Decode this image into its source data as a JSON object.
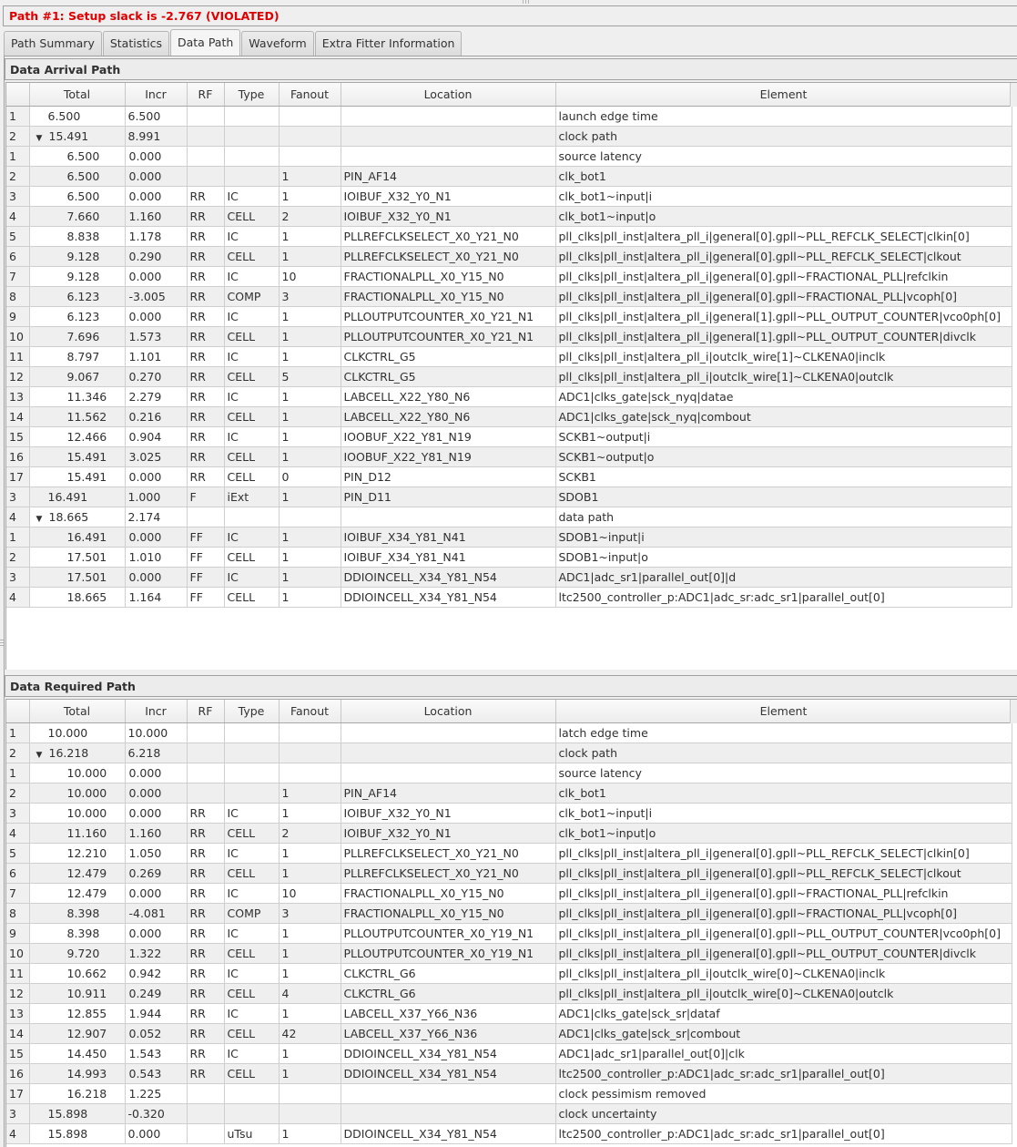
{
  "title": "Path #1: Setup slack is -2.767 (VIOLATED)",
  "colors": {
    "violation": "#e00000"
  },
  "tabs": [
    {
      "label": "Path Summary",
      "active": false
    },
    {
      "label": "Statistics",
      "active": false
    },
    {
      "label": "Data Path",
      "active": true
    },
    {
      "label": "Waveform",
      "active": false
    },
    {
      "label": "Extra Fitter Information",
      "active": false
    }
  ],
  "columns": [
    "",
    "Total",
    "Incr",
    "RF",
    "Type",
    "Fanout",
    "Location",
    "Element"
  ],
  "arrival": {
    "title": "Data Arrival Path",
    "rows": [
      {
        "n": "1",
        "level": 0,
        "total": "6.500",
        "incr": "6.500",
        "rf": "",
        "type": "",
        "fanout": "",
        "location": "",
        "element": "launch edge time"
      },
      {
        "n": "2",
        "level": 0,
        "expanded": true,
        "total": "15.491",
        "incr": "8.991",
        "rf": "",
        "type": "",
        "fanout": "",
        "location": "",
        "element": "clock path"
      },
      {
        "n": "1",
        "level": 1,
        "total": "6.500",
        "incr": "0.000",
        "rf": "",
        "type": "",
        "fanout": "",
        "location": "",
        "element": "source latency"
      },
      {
        "n": "2",
        "level": 1,
        "total": "6.500",
        "incr": "0.000",
        "rf": "",
        "type": "",
        "fanout": "1",
        "location": "PIN_AF14",
        "element": "clk_bot1"
      },
      {
        "n": "3",
        "level": 1,
        "total": "6.500",
        "incr": "0.000",
        "rf": "RR",
        "type": "IC",
        "fanout": "1",
        "location": "IOIBUF_X32_Y0_N1",
        "element": "clk_bot1~input|i"
      },
      {
        "n": "4",
        "level": 1,
        "total": "7.660",
        "incr": "1.160",
        "rf": "RR",
        "type": "CELL",
        "fanout": "2",
        "location": "IOIBUF_X32_Y0_N1",
        "element": "clk_bot1~input|o"
      },
      {
        "n": "5",
        "level": 1,
        "total": "8.838",
        "incr": "1.178",
        "rf": "RR",
        "type": "IC",
        "fanout": "1",
        "location": "PLLREFCLKSELECT_X0_Y21_N0",
        "element": "pll_clks|pll_inst|altera_pll_i|general[0].gpll~PLL_REFCLK_SELECT|clkin[0]"
      },
      {
        "n": "6",
        "level": 1,
        "total": "9.128",
        "incr": "0.290",
        "rf": "RR",
        "type": "CELL",
        "fanout": "1",
        "location": "PLLREFCLKSELECT_X0_Y21_N0",
        "element": "pll_clks|pll_inst|altera_pll_i|general[0].gpll~PLL_REFCLK_SELECT|clkout"
      },
      {
        "n": "7",
        "level": 1,
        "total": "9.128",
        "incr": "0.000",
        "rf": "RR",
        "type": "IC",
        "fanout": "10",
        "location": "FRACTIONALPLL_X0_Y15_N0",
        "element": "pll_clks|pll_inst|altera_pll_i|general[0].gpll~FRACTIONAL_PLL|refclkin"
      },
      {
        "n": "8",
        "level": 1,
        "total": "6.123",
        "incr": "-3.005",
        "rf": "RR",
        "type": "COMP",
        "fanout": "3",
        "location": "FRACTIONALPLL_X0_Y15_N0",
        "element": "pll_clks|pll_inst|altera_pll_i|general[0].gpll~FRACTIONAL_PLL|vcoph[0]"
      },
      {
        "n": "9",
        "level": 1,
        "total": "6.123",
        "incr": "0.000",
        "rf": "RR",
        "type": "IC",
        "fanout": "1",
        "location": "PLLOUTPUTCOUNTER_X0_Y21_N1",
        "element": "pll_clks|pll_inst|altera_pll_i|general[1].gpll~PLL_OUTPUT_COUNTER|vco0ph[0]"
      },
      {
        "n": "10",
        "level": 1,
        "total": "7.696",
        "incr": "1.573",
        "rf": "RR",
        "type": "CELL",
        "fanout": "1",
        "location": "PLLOUTPUTCOUNTER_X0_Y21_N1",
        "element": "pll_clks|pll_inst|altera_pll_i|general[1].gpll~PLL_OUTPUT_COUNTER|divclk"
      },
      {
        "n": "11",
        "level": 1,
        "total": "8.797",
        "incr": "1.101",
        "rf": "RR",
        "type": "IC",
        "fanout": "1",
        "location": "CLKCTRL_G5",
        "element": "pll_clks|pll_inst|altera_pll_i|outclk_wire[1]~CLKENA0|inclk"
      },
      {
        "n": "12",
        "level": 1,
        "total": "9.067",
        "incr": "0.270",
        "rf": "RR",
        "type": "CELL",
        "fanout": "5",
        "location": "CLKCTRL_G5",
        "element": "pll_clks|pll_inst|altera_pll_i|outclk_wire[1]~CLKENA0|outclk"
      },
      {
        "n": "13",
        "level": 1,
        "total": "11.346",
        "incr": "2.279",
        "rf": "RR",
        "type": "IC",
        "fanout": "1",
        "location": "LABCELL_X22_Y80_N6",
        "element": "ADC1|clks_gate|sck_nyq|datae"
      },
      {
        "n": "14",
        "level": 1,
        "total": "11.562",
        "incr": "0.216",
        "rf": "RR",
        "type": "CELL",
        "fanout": "1",
        "location": "LABCELL_X22_Y80_N6",
        "element": "ADC1|clks_gate|sck_nyq|combout"
      },
      {
        "n": "15",
        "level": 1,
        "total": "12.466",
        "incr": "0.904",
        "rf": "RR",
        "type": "IC",
        "fanout": "1",
        "location": "IOOBUF_X22_Y81_N19",
        "element": "SCKB1~output|i"
      },
      {
        "n": "16",
        "level": 1,
        "total": "15.491",
        "incr": "3.025",
        "rf": "RR",
        "type": "CELL",
        "fanout": "1",
        "location": "IOOBUF_X22_Y81_N19",
        "element": "SCKB1~output|o"
      },
      {
        "n": "17",
        "level": 1,
        "total": "15.491",
        "incr": "0.000",
        "rf": "RR",
        "type": "CELL",
        "fanout": "0",
        "location": "PIN_D12",
        "element": "SCKB1"
      },
      {
        "n": "3",
        "level": 0,
        "total": "16.491",
        "incr": "1.000",
        "rf": "F",
        "type": "iExt",
        "fanout": "1",
        "location": "PIN_D11",
        "element": "SDOB1"
      },
      {
        "n": "4",
        "level": 0,
        "expanded": true,
        "total": "18.665",
        "incr": "2.174",
        "rf": "",
        "type": "",
        "fanout": "",
        "location": "",
        "element": "data path"
      },
      {
        "n": "1",
        "level": 1,
        "total": "16.491",
        "incr": "0.000",
        "rf": "FF",
        "type": "IC",
        "fanout": "1",
        "location": "IOIBUF_X34_Y81_N41",
        "element": "SDOB1~input|i"
      },
      {
        "n": "2",
        "level": 1,
        "total": "17.501",
        "incr": "1.010",
        "rf": "FF",
        "type": "CELL",
        "fanout": "1",
        "location": "IOIBUF_X34_Y81_N41",
        "element": "SDOB1~input|o"
      },
      {
        "n": "3",
        "level": 1,
        "total": "17.501",
        "incr": "0.000",
        "rf": "FF",
        "type": "IC",
        "fanout": "1",
        "location": "DDIOINCELL_X34_Y81_N54",
        "element": "ADC1|adc_sr1|parallel_out[0]|d"
      },
      {
        "n": "4",
        "level": 1,
        "total": "18.665",
        "incr": "1.164",
        "rf": "FF",
        "type": "CELL",
        "fanout": "1",
        "location": "DDIOINCELL_X34_Y81_N54",
        "element": "ltc2500_controller_p:ADC1|adc_sr:adc_sr1|parallel_out[0]"
      }
    ]
  },
  "required": {
    "title": "Data Required Path",
    "rows": [
      {
        "n": "1",
        "level": 0,
        "total": "10.000",
        "incr": "10.000",
        "rf": "",
        "type": "",
        "fanout": "",
        "location": "",
        "element": "latch edge time"
      },
      {
        "n": "2",
        "level": 0,
        "expanded": true,
        "total": "16.218",
        "incr": "6.218",
        "rf": "",
        "type": "",
        "fanout": "",
        "location": "",
        "element": "clock path"
      },
      {
        "n": "1",
        "level": 1,
        "total": "10.000",
        "incr": "0.000",
        "rf": "",
        "type": "",
        "fanout": "",
        "location": "",
        "element": "source latency"
      },
      {
        "n": "2",
        "level": 1,
        "total": "10.000",
        "incr": "0.000",
        "rf": "",
        "type": "",
        "fanout": "1",
        "location": "PIN_AF14",
        "element": "clk_bot1"
      },
      {
        "n": "3",
        "level": 1,
        "total": "10.000",
        "incr": "0.000",
        "rf": "RR",
        "type": "IC",
        "fanout": "1",
        "location": "IOIBUF_X32_Y0_N1",
        "element": "clk_bot1~input|i"
      },
      {
        "n": "4",
        "level": 1,
        "total": "11.160",
        "incr": "1.160",
        "rf": "RR",
        "type": "CELL",
        "fanout": "2",
        "location": "IOIBUF_X32_Y0_N1",
        "element": "clk_bot1~input|o"
      },
      {
        "n": "5",
        "level": 1,
        "total": "12.210",
        "incr": "1.050",
        "rf": "RR",
        "type": "IC",
        "fanout": "1",
        "location": "PLLREFCLKSELECT_X0_Y21_N0",
        "element": "pll_clks|pll_inst|altera_pll_i|general[0].gpll~PLL_REFCLK_SELECT|clkin[0]"
      },
      {
        "n": "6",
        "level": 1,
        "total": "12.479",
        "incr": "0.269",
        "rf": "RR",
        "type": "CELL",
        "fanout": "1",
        "location": "PLLREFCLKSELECT_X0_Y21_N0",
        "element": "pll_clks|pll_inst|altera_pll_i|general[0].gpll~PLL_REFCLK_SELECT|clkout"
      },
      {
        "n": "7",
        "level": 1,
        "total": "12.479",
        "incr": "0.000",
        "rf": "RR",
        "type": "IC",
        "fanout": "10",
        "location": "FRACTIONALPLL_X0_Y15_N0",
        "element": "pll_clks|pll_inst|altera_pll_i|general[0].gpll~FRACTIONAL_PLL|refclkin"
      },
      {
        "n": "8",
        "level": 1,
        "total": "8.398",
        "incr": "-4.081",
        "rf": "RR",
        "type": "COMP",
        "fanout": "3",
        "location": "FRACTIONALPLL_X0_Y15_N0",
        "element": "pll_clks|pll_inst|altera_pll_i|general[0].gpll~FRACTIONAL_PLL|vcoph[0]"
      },
      {
        "n": "9",
        "level": 1,
        "total": "8.398",
        "incr": "0.000",
        "rf": "RR",
        "type": "IC",
        "fanout": "1",
        "location": "PLLOUTPUTCOUNTER_X0_Y19_N1",
        "element": "pll_clks|pll_inst|altera_pll_i|general[0].gpll~PLL_OUTPUT_COUNTER|vco0ph[0]"
      },
      {
        "n": "10",
        "level": 1,
        "total": "9.720",
        "incr": "1.322",
        "rf": "RR",
        "type": "CELL",
        "fanout": "1",
        "location": "PLLOUTPUTCOUNTER_X0_Y19_N1",
        "element": "pll_clks|pll_inst|altera_pll_i|general[0].gpll~PLL_OUTPUT_COUNTER|divclk"
      },
      {
        "n": "11",
        "level": 1,
        "total": "10.662",
        "incr": "0.942",
        "rf": "RR",
        "type": "IC",
        "fanout": "1",
        "location": "CLKCTRL_G6",
        "element": "pll_clks|pll_inst|altera_pll_i|outclk_wire[0]~CLKENA0|inclk"
      },
      {
        "n": "12",
        "level": 1,
        "total": "10.911",
        "incr": "0.249",
        "rf": "RR",
        "type": "CELL",
        "fanout": "4",
        "location": "CLKCTRL_G6",
        "element": "pll_clks|pll_inst|altera_pll_i|outclk_wire[0]~CLKENA0|outclk"
      },
      {
        "n": "13",
        "level": 1,
        "total": "12.855",
        "incr": "1.944",
        "rf": "RR",
        "type": "IC",
        "fanout": "1",
        "location": "LABCELL_X37_Y66_N36",
        "element": "ADC1|clks_gate|sck_sr|dataf"
      },
      {
        "n": "14",
        "level": 1,
        "total": "12.907",
        "incr": "0.052",
        "rf": "RR",
        "type": "CELL",
        "fanout": "42",
        "location": "LABCELL_X37_Y66_N36",
        "element": "ADC1|clks_gate|sck_sr|combout"
      },
      {
        "n": "15",
        "level": 1,
        "total": "14.450",
        "incr": "1.543",
        "rf": "RR",
        "type": "IC",
        "fanout": "1",
        "location": "DDIOINCELL_X34_Y81_N54",
        "element": "ADC1|adc_sr1|parallel_out[0]|clk"
      },
      {
        "n": "16",
        "level": 1,
        "total": "14.993",
        "incr": "0.543",
        "rf": "RR",
        "type": "CELL",
        "fanout": "1",
        "location": "DDIOINCELL_X34_Y81_N54",
        "element": "ltc2500_controller_p:ADC1|adc_sr:adc_sr1|parallel_out[0]"
      },
      {
        "n": "17",
        "level": 1,
        "total": "16.218",
        "incr": "1.225",
        "rf": "",
        "type": "",
        "fanout": "",
        "location": "",
        "element": "clock pessimism removed"
      },
      {
        "n": "3",
        "level": 0,
        "total": "15.898",
        "incr": "-0.320",
        "rf": "",
        "type": "",
        "fanout": "",
        "location": "",
        "element": "clock uncertainty"
      },
      {
        "n": "4",
        "level": 0,
        "total": "15.898",
        "incr": "0.000",
        "rf": "",
        "type": "uTsu",
        "fanout": "1",
        "location": "DDIOINCELL_X34_Y81_N54",
        "element": "ltc2500_controller_p:ADC1|adc_sr:adc_sr1|parallel_out[0]"
      }
    ]
  }
}
